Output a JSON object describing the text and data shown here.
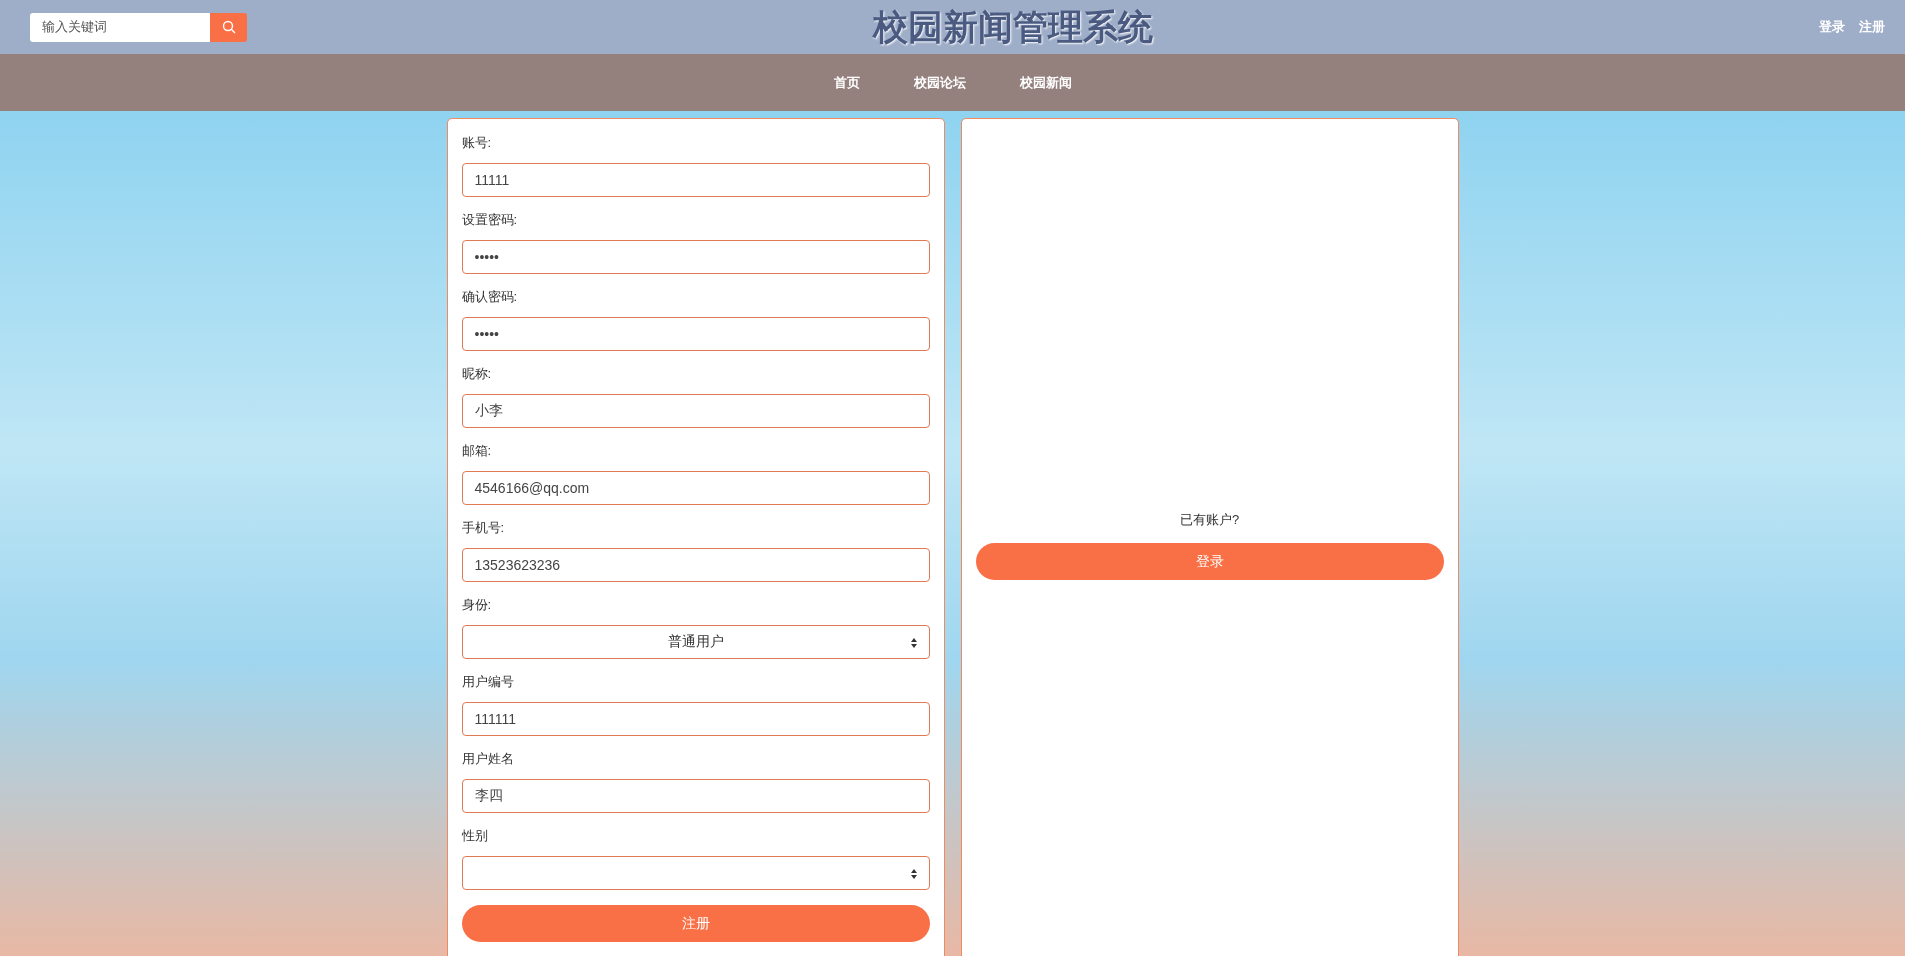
{
  "header": {
    "search": {
      "placeholder": "输入关键词"
    },
    "title": "校园新闻管理系统",
    "links": [
      "登录",
      "注册"
    ]
  },
  "nav": {
    "items": [
      "首页",
      "校园论坛",
      "校园新闻"
    ]
  },
  "register_form": {
    "fields": [
      {
        "kind": "input",
        "label": "账号:",
        "value": "11111"
      },
      {
        "kind": "input",
        "label": "设置密码:",
        "value": "•••••"
      },
      {
        "kind": "input",
        "label": "确认密码:",
        "value": "•••••"
      },
      {
        "kind": "input",
        "label": "昵称:",
        "value": "小李"
      },
      {
        "kind": "input",
        "label": "邮箱:",
        "value": "4546166@qq.com"
      },
      {
        "kind": "input",
        "label": "手机号:",
        "value": "13523623236"
      },
      {
        "kind": "select",
        "label": "身份:",
        "value": "普通用户"
      },
      {
        "kind": "input",
        "label": "用户编号",
        "value": "111111"
      },
      {
        "kind": "input",
        "label": "用户姓名",
        "value": "李四"
      },
      {
        "kind": "select",
        "label": "性别"
      }
    ],
    "submit": "注册"
  },
  "login_panel": {
    "prompt": "已有账户?",
    "button": "登录"
  }
}
